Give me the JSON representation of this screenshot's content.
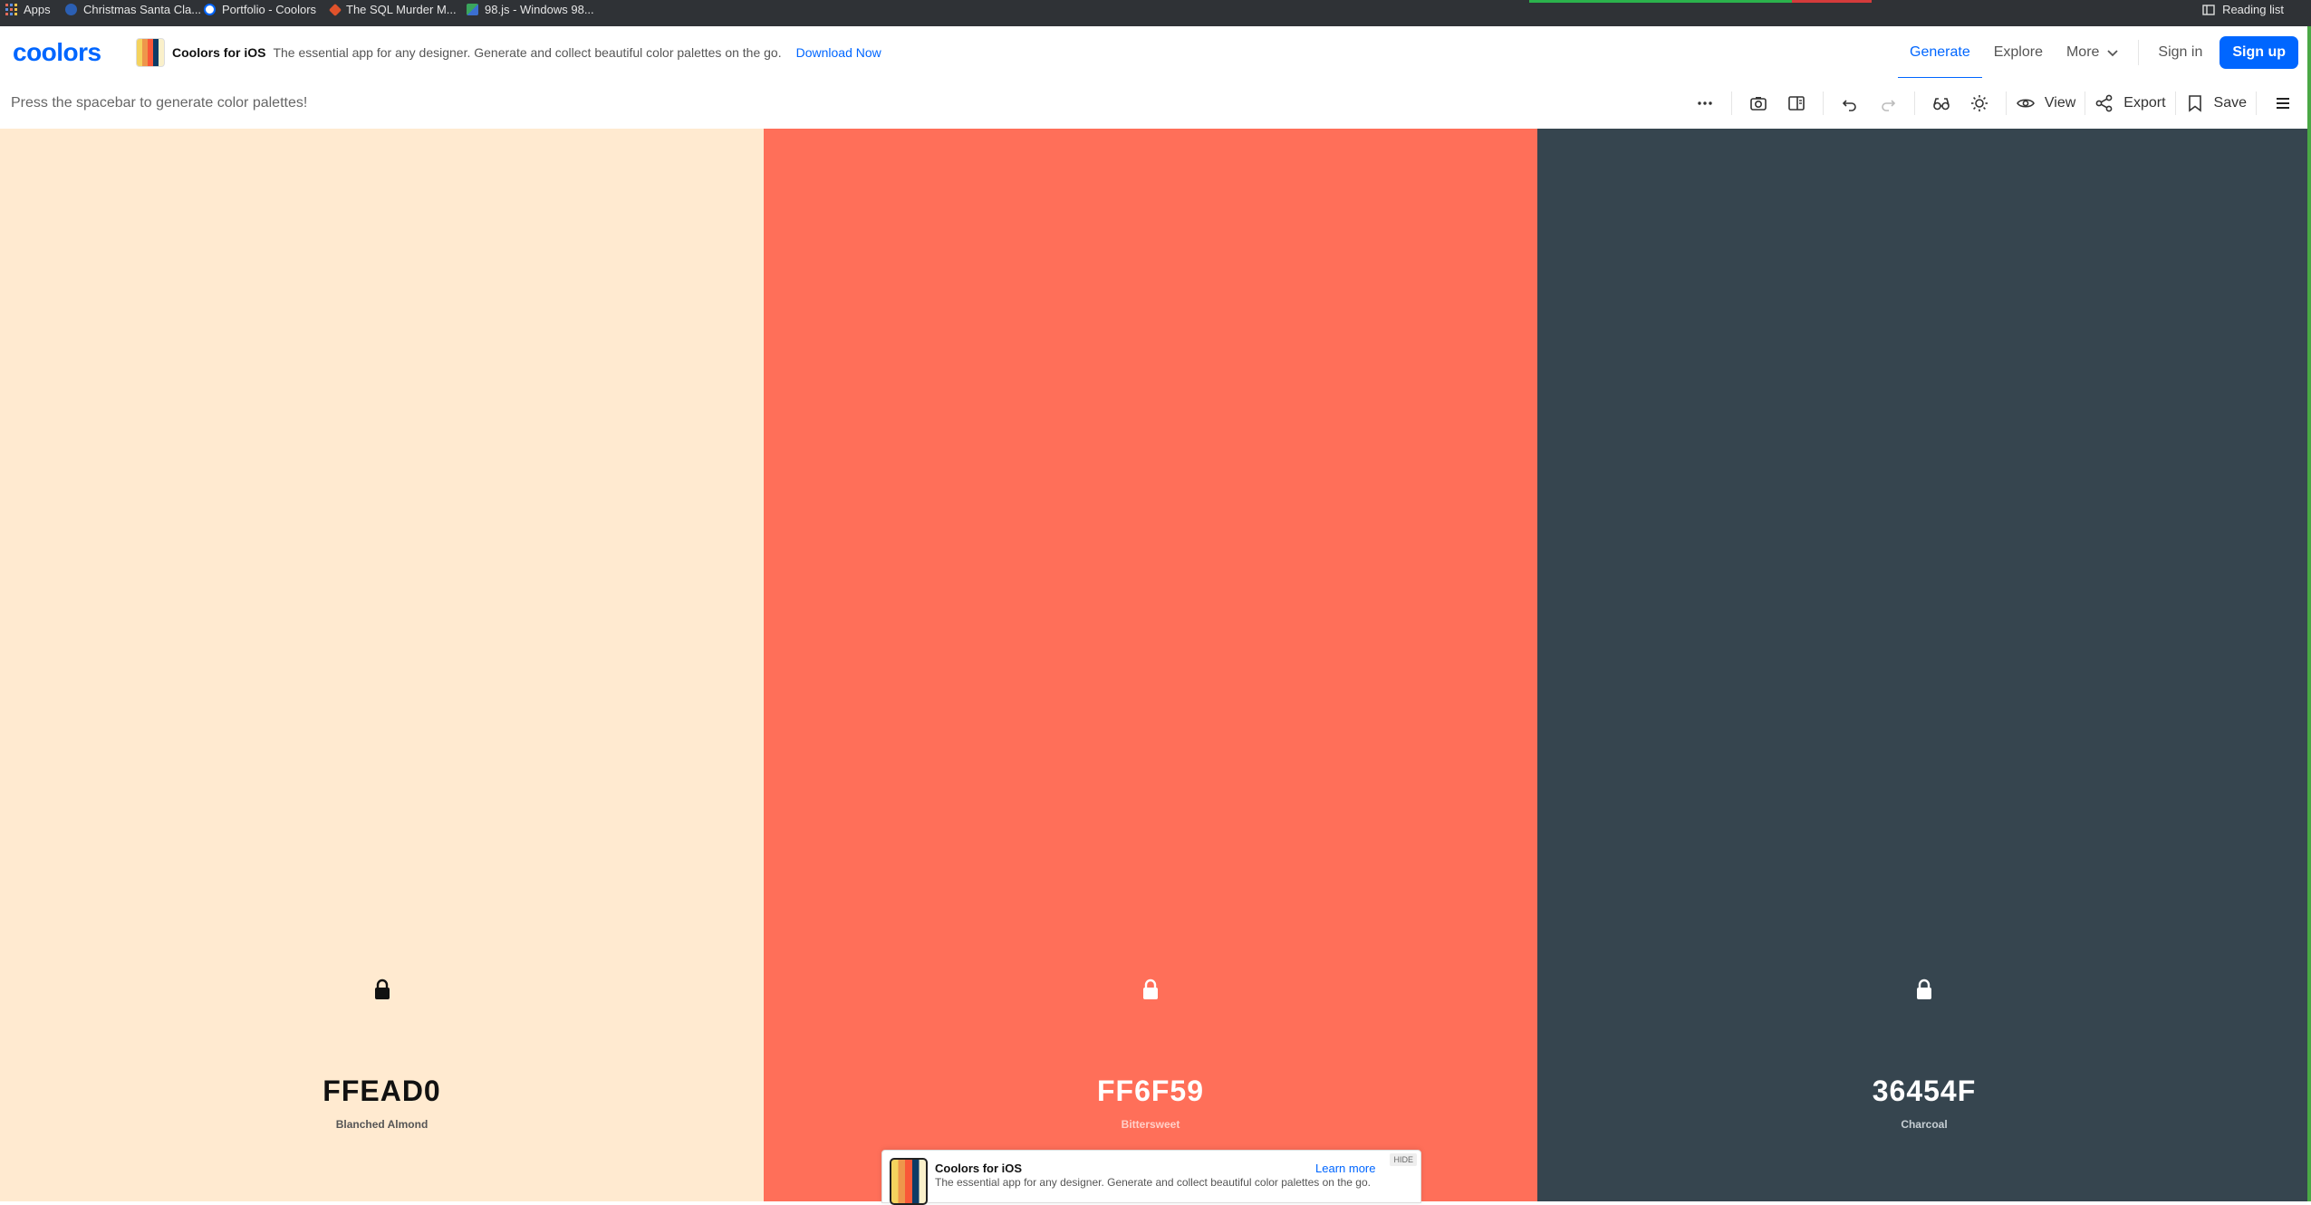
{
  "bookmarks": {
    "items": [
      {
        "label": "Apps"
      },
      {
        "label": "Christmas Santa Cla..."
      },
      {
        "label": "Portfolio - Coolors"
      },
      {
        "label": "The SQL Murder M..."
      },
      {
        "label": "98.js - Windows 98..."
      }
    ],
    "reading_list": "Reading list"
  },
  "header": {
    "logo": "coolors",
    "promo_app": "Coolors for iOS",
    "promo_text": "The essential app for any designer. Generate and collect beautiful color palettes on the go.",
    "promo_link": "Download Now",
    "nav": {
      "generate": "Generate",
      "explore": "Explore",
      "more": "More",
      "sign_in": "Sign in",
      "sign_up": "Sign up"
    },
    "brand_color": "#0066ff"
  },
  "toolbar": {
    "hint": "Press the spacebar to generate color palettes!",
    "view_label": "View",
    "export_label": "Export",
    "save_label": "Save"
  },
  "palette": [
    {
      "hex": "FFEAD0",
      "name": "Blanched Almond",
      "bg": "#FFEAD0",
      "fg": "#111111",
      "sub": "#555555"
    },
    {
      "hex": "FF6F59",
      "name": "Bittersweet",
      "bg": "#FF6F59",
      "fg": "#ffffff",
      "sub": "#ffd0c8"
    },
    {
      "hex": "36454F",
      "name": "Charcoal",
      "bg": "#36454F",
      "fg": "#ffffff",
      "sub": "#c7cfd4"
    }
  ],
  "ad": {
    "title": "Coolors for iOS",
    "text": "The essential app for any designer. Generate and collect beautiful color palettes on the go.",
    "link": "Learn more",
    "hide": "HIDE"
  }
}
